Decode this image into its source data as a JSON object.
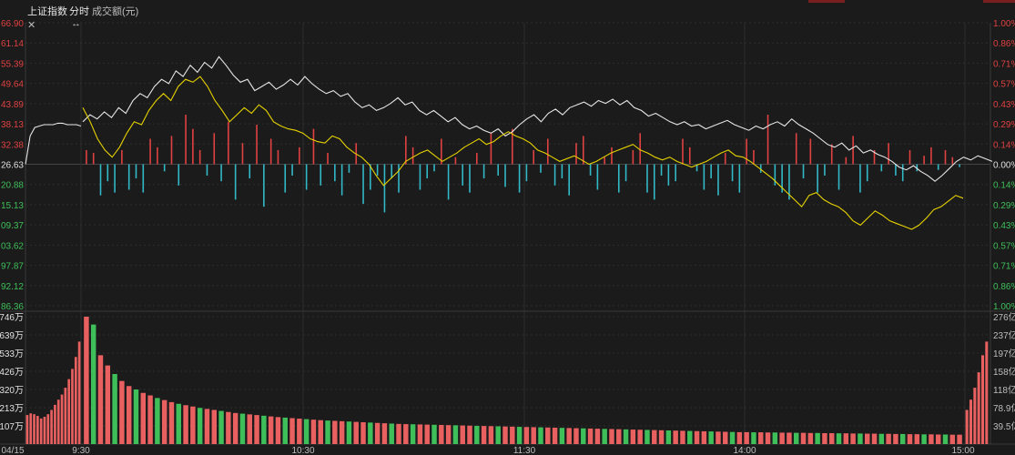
{
  "header": {
    "index_name": "上证指数",
    "tab_label": "分时",
    "metric_label": "成交额(元)"
  },
  "colors": {
    "background": "#1b1b1b",
    "grid": "#2e2e2e",
    "up": "#e04141",
    "down": "#32b9c8",
    "price_line": "#e6e6e6",
    "avg_line": "#e6d200",
    "vol_up": "#e86060",
    "vol_down": "#3fbf5a"
  },
  "icons": [
    "close-icon",
    "resize-icon"
  ],
  "chart_data": [
    {
      "type": "line",
      "name": "price",
      "y_ticks_left": [
        "66.90",
        "61.14",
        "55.39",
        "49.64",
        "43.89",
        "38.13",
        "32.38",
        "26.63",
        "20.88",
        "15.13",
        "09.37",
        "03.62",
        "97.87",
        "92.12",
        "86.36"
      ],
      "y_ticks_right": [
        "1.00%",
        "0.86%",
        "0.71%",
        "0.57%",
        "0.43%",
        "0.29%",
        "0.14%",
        "0.00%",
        "0.14%",
        "0.29%",
        "0.43%",
        "0.57%",
        "0.71%",
        "0.86%",
        "1.00%"
      ],
      "x_ticks": [
        "04/15",
        "9:30",
        "10:30",
        "11:30",
        "14:00",
        "15:00"
      ],
      "baseline_pct": 0,
      "ylim_pct": [
        -1.0,
        1.0
      ],
      "grid": true,
      "series": [
        {
          "role": "pre-session",
          "values": [
            0.0,
            0.2,
            0.26,
            0.27,
            0.28,
            0.28,
            0.28,
            0.29,
            0.29,
            0.28,
            0.28,
            0.28,
            0.27
          ]
        },
        {
          "role": "price",
          "values": [
            0.3,
            0.35,
            0.32,
            0.37,
            0.33,
            0.4,
            0.36,
            0.45,
            0.5,
            0.47,
            0.55,
            0.6,
            0.57,
            0.66,
            0.62,
            0.7,
            0.65,
            0.72,
            0.68,
            0.76,
            0.7,
            0.63,
            0.58,
            0.6,
            0.52,
            0.55,
            0.58,
            0.53,
            0.56,
            0.6,
            0.56,
            0.62,
            0.57,
            0.53,
            0.5,
            0.52,
            0.48,
            0.5,
            0.44,
            0.4,
            0.42,
            0.38,
            0.4,
            0.43,
            0.47,
            0.42,
            0.44,
            0.38,
            0.35,
            0.38,
            0.34,
            0.3,
            0.33,
            0.28,
            0.25,
            0.27,
            0.24,
            0.22,
            0.25,
            0.2,
            0.23,
            0.28,
            0.32,
            0.35,
            0.3,
            0.36,
            0.39,
            0.35,
            0.4,
            0.42,
            0.44,
            0.41,
            0.45,
            0.43,
            0.46,
            0.42,
            0.45,
            0.4,
            0.38,
            0.34,
            0.36,
            0.33,
            0.3,
            0.28,
            0.3,
            0.27,
            0.28,
            0.25,
            0.27,
            0.29,
            0.31,
            0.28,
            0.26,
            0.24,
            0.27,
            0.25,
            0.28,
            0.3,
            0.27,
            0.32,
            0.28,
            0.25,
            0.22,
            0.18,
            0.14,
            0.12,
            0.15,
            0.1,
            0.13,
            0.08,
            0.1,
            0.07,
            0.05,
            0.02,
            -0.02,
            -0.04,
            -0.01,
            -0.05,
            -0.08,
            -0.12,
            -0.08,
            -0.03,
            0.02,
            0.05,
            0.03,
            0.06,
            0.04,
            0.02
          ]
        },
        {
          "role": "average",
          "values": [
            0.4,
            0.3,
            0.18,
            0.1,
            0.05,
            0.12,
            0.22,
            0.3,
            0.28,
            0.38,
            0.45,
            0.5,
            0.45,
            0.55,
            0.6,
            0.58,
            0.62,
            0.55,
            0.45,
            0.38,
            0.3,
            0.35,
            0.4,
            0.36,
            0.42,
            0.38,
            0.3,
            0.27,
            0.25,
            0.24,
            0.22,
            0.18,
            0.16,
            0.15,
            0.2,
            0.18,
            0.12,
            0.08,
            0.05,
            0.0,
            -0.08,
            -0.15,
            -0.1,
            -0.05,
            0.02,
            0.05,
            0.08,
            0.1,
            0.06,
            0.02,
            0.05,
            0.08,
            0.12,
            0.15,
            0.18,
            0.14,
            0.16,
            0.2,
            0.23,
            0.2,
            0.18,
            0.15,
            0.1,
            0.08,
            0.05,
            0.02,
            0.04,
            0.06,
            0.03,
            0.0,
            0.02,
            0.05,
            0.08,
            0.1,
            0.12,
            0.14,
            0.1,
            0.08,
            0.05,
            0.03,
            0.05,
            0.02,
            0.0,
            -0.02,
            0.0,
            0.02,
            0.05,
            0.08,
            0.1,
            0.06,
            0.05,
            0.02,
            -0.02,
            -0.06,
            -0.1,
            -0.15,
            -0.2,
            -0.25,
            -0.3,
            -0.22,
            -0.2,
            -0.25,
            -0.28,
            -0.3,
            -0.34,
            -0.4,
            -0.43,
            -0.38,
            -0.33,
            -0.36,
            -0.4,
            -0.42,
            -0.44,
            -0.46,
            -0.43,
            -0.38,
            -0.32,
            -0.3,
            -0.26,
            -0.22,
            -0.24
          ]
        }
      ]
    },
    {
      "type": "bar",
      "name": "bid-ask-spread",
      "values": [
        0.1,
        0.08,
        -0.22,
        -0.12,
        -0.2,
        0.1,
        -0.18,
        -0.1,
        -0.2,
        0.18,
        0.12,
        -0.05,
        0.2,
        -0.15,
        0.35,
        0.25,
        0.1,
        -0.08,
        0.22,
        -0.12,
        0.3,
        -0.25,
        0.15,
        -0.1,
        0.28,
        -0.3,
        0.18,
        0.1,
        -0.2,
        -0.08,
        0.12,
        -0.18,
        0.25,
        -0.15,
        0.08,
        -0.12,
        -0.22,
        -0.06,
        0.15,
        -0.28,
        -0.18,
        -0.08,
        -0.34,
        -0.1,
        -0.2,
        0.2,
        0.12,
        -0.18,
        -0.1,
        -0.05,
        0.18,
        -0.25,
        0.05,
        -0.15,
        -0.2,
        0.08,
        -0.1,
        0.22,
        -0.08,
        -0.16,
        0.25,
        -0.2,
        -0.12,
        0.1,
        -0.06,
        0.18,
        -0.15,
        -0.1,
        -0.22,
        0.15,
        0.2,
        -0.08,
        -0.18,
        0.05,
        0.12,
        -0.2,
        -0.12,
        0.1,
        0.22,
        -0.2,
        -0.25,
        -0.08,
        -0.15,
        -0.12,
        0.18,
        0.12,
        -0.05,
        -0.18,
        -0.1,
        -0.22,
        0.08,
        -0.12,
        -0.2,
        0.18,
        0.1,
        -0.06,
        0.35,
        -0.15,
        -0.2,
        -0.25,
        0.22,
        -0.1,
        0.18,
        -0.2,
        -0.08,
        0.14,
        -0.18,
        0.05,
        0.2,
        -0.2,
        -0.12,
        0.1,
        -0.05,
        0.15,
        -0.08,
        -0.12,
        0.1,
        -0.05,
        0.06,
        0.12,
        -0.04,
        0.1,
        0.05,
        -0.02
      ]
    },
    {
      "type": "bar",
      "name": "volume",
      "y_ticks_left": [
        "746万",
        "639万",
        "533万",
        "426万",
        "320万",
        "213万",
        "107万"
      ],
      "y_ticks_right": [
        "276亿",
        "237亿",
        "197亿",
        "158亿",
        "118亿",
        "78.9亿",
        "39.5亿"
      ],
      "pre_session_values": [
        170,
        180,
        175,
        165,
        150,
        160,
        175,
        200,
        230,
        260,
        290,
        330,
        380,
        440,
        510,
        600
      ],
      "values": [
        746,
        700,
        520,
        460,
        410,
        370,
        340,
        320,
        300,
        285,
        270,
        258,
        246,
        236,
        228,
        220,
        212,
        206,
        200,
        194,
        188,
        182,
        178,
        174,
        170,
        166,
        162,
        158,
        155,
        152,
        149,
        146,
        143,
        140,
        138,
        136,
        134,
        132,
        130,
        128,
        126,
        124,
        122,
        120,
        118,
        117,
        116,
        115,
        114,
        113,
        112,
        111,
        110,
        109,
        108,
        107,
        106,
        105,
        104,
        103,
        102,
        101,
        100,
        99,
        98,
        97,
        96,
        95,
        94,
        93,
        92,
        91,
        90,
        89,
        88,
        87,
        86,
        85,
        84,
        83,
        82,
        81,
        80,
        79,
        78,
        77,
        76,
        75,
        74,
        73,
        72,
        71,
        70,
        70,
        69,
        69,
        68,
        68,
        67,
        67,
        66,
        66,
        65,
        65,
        64,
        64,
        63,
        63,
        62,
        62,
        61,
        61,
        60,
        60,
        59,
        59,
        58,
        58,
        57,
        57,
        56,
        56,
        55,
        55
      ],
      "closing_auction_values": [
        200,
        260,
        330,
        420,
        520,
        600
      ],
      "ylim": [
        0,
        746
      ]
    }
  ]
}
